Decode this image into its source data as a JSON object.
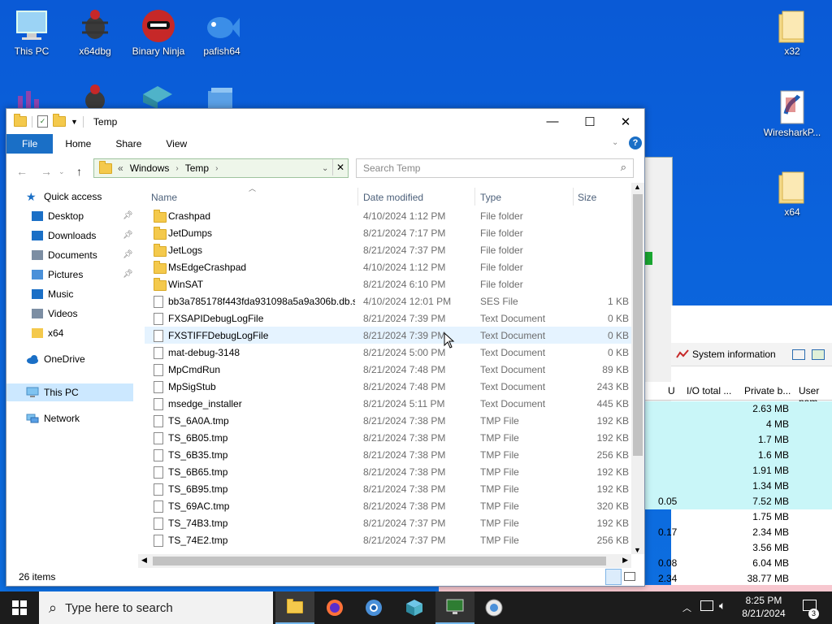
{
  "desktop": {
    "icons": [
      {
        "label": "This PC"
      },
      {
        "label": "x64dbg"
      },
      {
        "label": "Binary Ninja"
      },
      {
        "label": "pafish64"
      },
      {
        "label": "x32"
      },
      {
        "label": "WiresharkP..."
      },
      {
        "label": "x64"
      }
    ]
  },
  "process_window": {
    "toolbar_label": "System information",
    "columns": [
      "U",
      "I/O total ...",
      "Private b...",
      "User nam"
    ],
    "rows": [
      {
        "cpu": "",
        "private": "2.63 MB",
        "highlight": true
      },
      {
        "cpu": "",
        "private": "4 MB",
        "highlight": true
      },
      {
        "cpu": "",
        "private": "1.7 MB",
        "highlight": true
      },
      {
        "cpu": "",
        "private": "1.6 MB",
        "highlight": true
      },
      {
        "cpu": "",
        "private": "1.91 MB",
        "highlight": true
      },
      {
        "cpu": "",
        "private": "1.34 MB",
        "highlight": true
      },
      {
        "cpu": "0.05",
        "private": "7.52 MB",
        "highlight": true
      },
      {
        "cpu": "",
        "private": "1.75 MB",
        "highlight": false
      },
      {
        "cpu": "0.17",
        "private": "2.34 MB",
        "highlight": false
      },
      {
        "cpu": "",
        "private": "3.56 MB",
        "highlight": false
      },
      {
        "cpu": "0.08",
        "private": "6.04 MB",
        "highlight": false
      },
      {
        "cpu": "2.34",
        "private": "38.77 MB",
        "highlight": false
      }
    ]
  },
  "explorer": {
    "title": "Temp",
    "ribbon_tabs": [
      "File",
      "Home",
      "Share",
      "View"
    ],
    "address": {
      "prefix": "«",
      "segments": [
        "Windows",
        "Temp"
      ]
    },
    "search_placeholder": "Search Temp",
    "nav": {
      "quick_access": "Quick access",
      "items": [
        {
          "label": "Desktop",
          "pinned": true
        },
        {
          "label": "Downloads",
          "pinned": true
        },
        {
          "label": "Documents",
          "pinned": true
        },
        {
          "label": "Pictures",
          "pinned": true
        },
        {
          "label": "Music",
          "pinned": false
        },
        {
          "label": "Videos",
          "pinned": false
        },
        {
          "label": "x64",
          "pinned": false
        }
      ],
      "onedrive": "OneDrive",
      "this_pc": "This PC",
      "network": "Network"
    },
    "columns": {
      "name": "Name",
      "date": "Date modified",
      "type": "Type",
      "size": "Size"
    },
    "files": [
      {
        "name": "Crashpad",
        "date": "4/10/2024 1:12 PM",
        "type": "File folder",
        "size": "",
        "kind": "folder"
      },
      {
        "name": "JetDumps",
        "date": "8/21/2024 7:17 PM",
        "type": "File folder",
        "size": "",
        "kind": "folder"
      },
      {
        "name": "JetLogs",
        "date": "8/21/2024 7:37 PM",
        "type": "File folder",
        "size": "",
        "kind": "folder"
      },
      {
        "name": "MsEdgeCrashpad",
        "date": "4/10/2024 1:12 PM",
        "type": "File folder",
        "size": "",
        "kind": "folder"
      },
      {
        "name": "WinSAT",
        "date": "8/21/2024 6:10 PM",
        "type": "File folder",
        "size": "",
        "kind": "folder"
      },
      {
        "name": "bb3a785178f443fda931098a5a9a306b.db.s...",
        "date": "4/10/2024 12:01 PM",
        "type": "SES File",
        "size": "1 KB",
        "kind": "doc"
      },
      {
        "name": "FXSAPIDebugLogFile",
        "date": "8/21/2024 7:39 PM",
        "type": "Text Document",
        "size": "0 KB",
        "kind": "doc"
      },
      {
        "name": "FXSTIFFDebugLogFile",
        "date": "8/21/2024 7:39 PM",
        "type": "Text Document",
        "size": "0 KB",
        "kind": "doc",
        "hover": true
      },
      {
        "name": "mat-debug-3148",
        "date": "8/21/2024 5:00 PM",
        "type": "Text Document",
        "size": "0 KB",
        "kind": "doc"
      },
      {
        "name": "MpCmdRun",
        "date": "8/21/2024 7:48 PM",
        "type": "Text Document",
        "size": "89 KB",
        "kind": "doc"
      },
      {
        "name": "MpSigStub",
        "date": "8/21/2024 7:48 PM",
        "type": "Text Document",
        "size": "243 KB",
        "kind": "doc"
      },
      {
        "name": "msedge_installer",
        "date": "8/21/2024 5:11 PM",
        "type": "Text Document",
        "size": "445 KB",
        "kind": "doc"
      },
      {
        "name": "TS_6A0A.tmp",
        "date": "8/21/2024 7:38 PM",
        "type": "TMP File",
        "size": "192 KB",
        "kind": "doc"
      },
      {
        "name": "TS_6B05.tmp",
        "date": "8/21/2024 7:38 PM",
        "type": "TMP File",
        "size": "192 KB",
        "kind": "doc"
      },
      {
        "name": "TS_6B35.tmp",
        "date": "8/21/2024 7:38 PM",
        "type": "TMP File",
        "size": "256 KB",
        "kind": "doc"
      },
      {
        "name": "TS_6B65.tmp",
        "date": "8/21/2024 7:38 PM",
        "type": "TMP File",
        "size": "192 KB",
        "kind": "doc"
      },
      {
        "name": "TS_6B95.tmp",
        "date": "8/21/2024 7:38 PM",
        "type": "TMP File",
        "size": "192 KB",
        "kind": "doc"
      },
      {
        "name": "TS_69AC.tmp",
        "date": "8/21/2024 7:38 PM",
        "type": "TMP File",
        "size": "320 KB",
        "kind": "doc"
      },
      {
        "name": "TS_74B3.tmp",
        "date": "8/21/2024 7:37 PM",
        "type": "TMP File",
        "size": "192 KB",
        "kind": "doc"
      },
      {
        "name": "TS_74E2.tmp",
        "date": "8/21/2024 7:37 PM",
        "type": "TMP File",
        "size": "256 KB",
        "kind": "doc"
      }
    ],
    "status": "26 items"
  },
  "taskbar": {
    "search_placeholder": "Type here to search",
    "time": "8:25 PM",
    "date": "8/21/2024",
    "notification_count": "3"
  },
  "colors": {
    "accent": "#1a6fc6",
    "folder": "#f4c94c",
    "hover_row": "#e5f3ff",
    "desktop": "#0b63dc"
  }
}
